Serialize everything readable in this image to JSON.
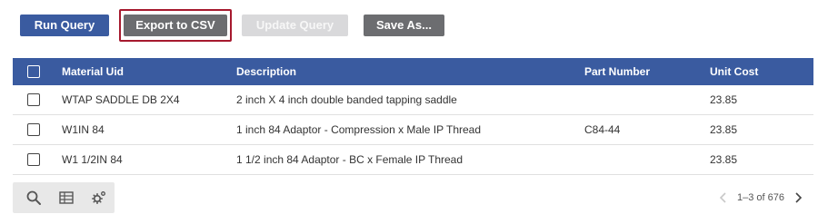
{
  "toolbar": {
    "run_query": "Run Query",
    "export_csv": "Export to CSV",
    "update_query": "Update Query",
    "save_as": "Save As..."
  },
  "table": {
    "headers": {
      "material_uid": "Material Uid",
      "description": "Description",
      "part_number": "Part Number",
      "unit_cost": "Unit Cost"
    },
    "rows": [
      {
        "material_uid": "WTAP SADDLE DB 2X4",
        "description": "2 inch X 4 inch double banded tapping saddle",
        "part_number": "",
        "unit_cost": "23.85"
      },
      {
        "material_uid": "W1IN 84",
        "description": "1 inch 84 Adaptor - Compression x Male IP Thread",
        "part_number": "C84-44",
        "unit_cost": "23.85"
      },
      {
        "material_uid": "W1 1/2IN 84",
        "description": "1 1/2 inch 84 Adaptor - BC x Female IP Thread",
        "part_number": "",
        "unit_cost": "23.85"
      }
    ]
  },
  "footer": {
    "icons": [
      "search-icon",
      "table-view-icon",
      "settings-icon"
    ],
    "pagination": "1–3 of 676"
  },
  "colors": {
    "primary": "#3a5ba0",
    "secondary": "#6c6d70",
    "disabled": "#d9d9db",
    "highlight_border": "#a6192e"
  }
}
